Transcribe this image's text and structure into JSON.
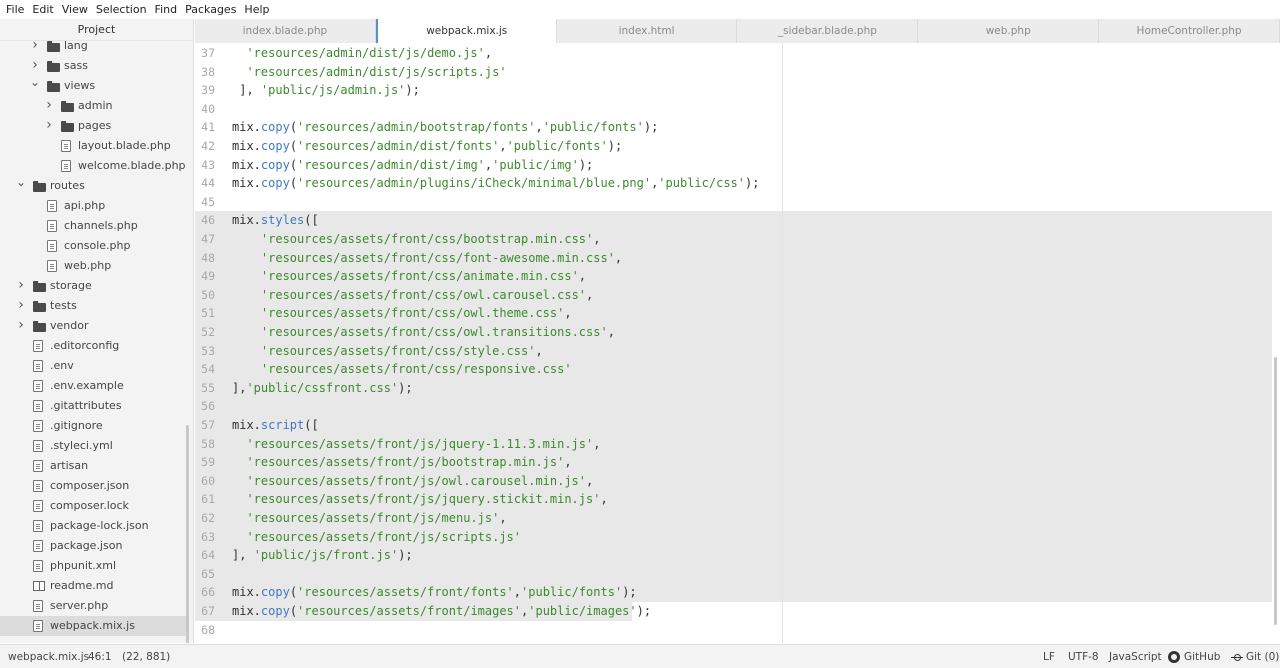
{
  "menubar": [
    "File",
    "Edit",
    "View",
    "Selection",
    "Find",
    "Packages",
    "Help"
  ],
  "sidebar": {
    "title": "Project",
    "items": [
      {
        "label": "lang",
        "kind": "folder",
        "depth": 2,
        "state": "collapsed",
        "icon": "folder-icon"
      },
      {
        "label": "sass",
        "kind": "folder",
        "depth": 2,
        "state": "collapsed",
        "icon": "folder-icon"
      },
      {
        "label": "views",
        "kind": "folder",
        "depth": 2,
        "state": "expanded",
        "icon": "folder-icon"
      },
      {
        "label": "admin",
        "kind": "folder",
        "depth": 3,
        "state": "collapsed",
        "icon": "folder-icon"
      },
      {
        "label": "pages",
        "kind": "folder",
        "depth": 3,
        "state": "collapsed",
        "icon": "folder-icon"
      },
      {
        "label": "layout.blade.php",
        "kind": "file",
        "depth": 3,
        "icon": "file-icon"
      },
      {
        "label": "welcome.blade.php",
        "kind": "file",
        "depth": 3,
        "icon": "file-icon"
      },
      {
        "label": "routes",
        "kind": "folder",
        "depth": 1,
        "state": "expanded",
        "icon": "folder-icon"
      },
      {
        "label": "api.php",
        "kind": "file",
        "depth": 2,
        "icon": "file-icon"
      },
      {
        "label": "channels.php",
        "kind": "file",
        "depth": 2,
        "icon": "file-icon"
      },
      {
        "label": "console.php",
        "kind": "file",
        "depth": 2,
        "icon": "file-icon"
      },
      {
        "label": "web.php",
        "kind": "file",
        "depth": 2,
        "icon": "file-icon"
      },
      {
        "label": "storage",
        "kind": "folder",
        "depth": 1,
        "state": "collapsed",
        "icon": "folder-icon"
      },
      {
        "label": "tests",
        "kind": "folder",
        "depth": 1,
        "state": "collapsed",
        "icon": "folder-icon"
      },
      {
        "label": "vendor",
        "kind": "folder",
        "depth": 1,
        "state": "collapsed",
        "icon": "folder-icon"
      },
      {
        "label": ".editorconfig",
        "kind": "file",
        "depth": 1,
        "icon": "file-icon"
      },
      {
        "label": ".env",
        "kind": "file",
        "depth": 1,
        "icon": "file-icon"
      },
      {
        "label": ".env.example",
        "kind": "file",
        "depth": 1,
        "icon": "file-icon"
      },
      {
        "label": ".gitattributes",
        "kind": "file",
        "depth": 1,
        "icon": "file-icon"
      },
      {
        "label": ".gitignore",
        "kind": "file",
        "depth": 1,
        "icon": "file-icon"
      },
      {
        "label": ".styleci.yml",
        "kind": "file",
        "depth": 1,
        "icon": "file-icon"
      },
      {
        "label": "artisan",
        "kind": "file",
        "depth": 1,
        "icon": "file-icon"
      },
      {
        "label": "composer.json",
        "kind": "file",
        "depth": 1,
        "icon": "file-icon"
      },
      {
        "label": "composer.lock",
        "kind": "file",
        "depth": 1,
        "icon": "file-icon"
      },
      {
        "label": "package-lock.json",
        "kind": "file",
        "depth": 1,
        "icon": "file-icon"
      },
      {
        "label": "package.json",
        "kind": "file",
        "depth": 1,
        "icon": "file-icon"
      },
      {
        "label": "phpunit.xml",
        "kind": "file",
        "depth": 1,
        "icon": "file-icon"
      },
      {
        "label": "readme.md",
        "kind": "file",
        "depth": 1,
        "icon": "book-icon"
      },
      {
        "label": "server.php",
        "kind": "file",
        "depth": 1,
        "icon": "file-icon"
      },
      {
        "label": "webpack.mix.js",
        "kind": "file",
        "depth": 1,
        "icon": "file-icon",
        "selected": true
      }
    ]
  },
  "tabs": [
    {
      "label": "index.blade.php",
      "active": false
    },
    {
      "label": "webpack.mix.js",
      "active": true
    },
    {
      "label": "index.html",
      "active": false
    },
    {
      "label": "_sidebar.blade.php",
      "active": false
    },
    {
      "label": "web.php",
      "active": false
    },
    {
      "label": "HomeController.php",
      "active": false
    }
  ],
  "editor": {
    "highlight_range": [
      46,
      67
    ],
    "lines": [
      {
        "n": "37",
        "tokens": [
          [
            "p",
            "  "
          ],
          [
            "s",
            "'resources/admin/dist/js/demo.js'"
          ],
          [
            "p",
            ","
          ]
        ]
      },
      {
        "n": "38",
        "tokens": [
          [
            "p",
            "  "
          ],
          [
            "s",
            "'resources/admin/dist/js/scripts.js'"
          ]
        ]
      },
      {
        "n": "39",
        "tokens": [
          [
            "p",
            " ], "
          ],
          [
            "s",
            "'public/js/admin.js'"
          ],
          [
            "p",
            ");"
          ]
        ]
      },
      {
        "n": "40",
        "tokens": []
      },
      {
        "n": "41",
        "tokens": [
          [
            "p",
            "mix."
          ],
          [
            "f",
            "copy"
          ],
          [
            "p",
            "("
          ],
          [
            "s",
            "'resources/admin/bootstrap/fonts'"
          ],
          [
            "p",
            ","
          ],
          [
            "s",
            "'public/fonts'"
          ],
          [
            "p",
            ");"
          ]
        ]
      },
      {
        "n": "42",
        "tokens": [
          [
            "p",
            "mix."
          ],
          [
            "f",
            "copy"
          ],
          [
            "p",
            "("
          ],
          [
            "s",
            "'resources/admin/dist/fonts'"
          ],
          [
            "p",
            ","
          ],
          [
            "s",
            "'public/fonts'"
          ],
          [
            "p",
            ");"
          ]
        ]
      },
      {
        "n": "43",
        "tokens": [
          [
            "p",
            "mix."
          ],
          [
            "f",
            "copy"
          ],
          [
            "p",
            "("
          ],
          [
            "s",
            "'resources/admin/dist/img'"
          ],
          [
            "p",
            ","
          ],
          [
            "s",
            "'public/img'"
          ],
          [
            "p",
            ");"
          ]
        ]
      },
      {
        "n": "44",
        "tokens": [
          [
            "p",
            "mix."
          ],
          [
            "f",
            "copy"
          ],
          [
            "p",
            "("
          ],
          [
            "s",
            "'resources/admin/plugins/iCheck/minimal/blue.png'"
          ],
          [
            "p",
            ","
          ],
          [
            "s",
            "'public/css'"
          ],
          [
            "p",
            ");"
          ]
        ]
      },
      {
        "n": "45",
        "tokens": []
      },
      {
        "n": "46",
        "tokens": [
          [
            "p",
            "mix."
          ],
          [
            "f",
            "styles"
          ],
          [
            "p",
            "(["
          ]
        ]
      },
      {
        "n": "47",
        "tokens": [
          [
            "p",
            "    "
          ],
          [
            "s",
            "'resources/assets/front/css/bootstrap.min.css'"
          ],
          [
            "p",
            ","
          ]
        ]
      },
      {
        "n": "48",
        "tokens": [
          [
            "p",
            "    "
          ],
          [
            "s",
            "'resources/assets/front/css/font-awesome.min.css'"
          ],
          [
            "p",
            ","
          ]
        ]
      },
      {
        "n": "49",
        "tokens": [
          [
            "p",
            "    "
          ],
          [
            "s",
            "'resources/assets/front/css/animate.min.css'"
          ],
          [
            "p",
            ","
          ]
        ]
      },
      {
        "n": "50",
        "tokens": [
          [
            "p",
            "    "
          ],
          [
            "s",
            "'resources/assets/front/css/owl.carousel.css'"
          ],
          [
            "p",
            ","
          ]
        ]
      },
      {
        "n": "51",
        "tokens": [
          [
            "p",
            "    "
          ],
          [
            "s",
            "'resources/assets/front/css/owl.theme.css'"
          ],
          [
            "p",
            ","
          ]
        ]
      },
      {
        "n": "52",
        "tokens": [
          [
            "p",
            "    "
          ],
          [
            "s",
            "'resources/assets/front/css/owl.transitions.css'"
          ],
          [
            "p",
            ","
          ]
        ]
      },
      {
        "n": "53",
        "tokens": [
          [
            "p",
            "    "
          ],
          [
            "s",
            "'resources/assets/front/css/style.css'"
          ],
          [
            "p",
            ","
          ]
        ]
      },
      {
        "n": "54",
        "tokens": [
          [
            "p",
            "    "
          ],
          [
            "s",
            "'resources/assets/front/css/responsive.css'"
          ]
        ]
      },
      {
        "n": "55",
        "tokens": [
          [
            "p",
            "],"
          ],
          [
            "s",
            "'public/cssfront.css'"
          ],
          [
            "p",
            ");"
          ]
        ]
      },
      {
        "n": "56",
        "tokens": []
      },
      {
        "n": "57",
        "tokens": [
          [
            "p",
            "mix."
          ],
          [
            "f",
            "script"
          ],
          [
            "p",
            "(["
          ]
        ]
      },
      {
        "n": "58",
        "tokens": [
          [
            "p",
            "  "
          ],
          [
            "s",
            "'resources/assets/front/js/jquery-1.11.3.min.js'"
          ],
          [
            "p",
            ","
          ]
        ]
      },
      {
        "n": "59",
        "tokens": [
          [
            "p",
            "  "
          ],
          [
            "s",
            "'resources/assets/front/js/bootstrap.min.js'"
          ],
          [
            "p",
            ","
          ]
        ]
      },
      {
        "n": "60",
        "tokens": [
          [
            "p",
            "  "
          ],
          [
            "s",
            "'resources/assets/front/js/owl.carousel.min.js'"
          ],
          [
            "p",
            ","
          ]
        ]
      },
      {
        "n": "61",
        "tokens": [
          [
            "p",
            "  "
          ],
          [
            "s",
            "'resources/assets/front/js/jquery.stickit.min.js'"
          ],
          [
            "p",
            ","
          ]
        ]
      },
      {
        "n": "62",
        "tokens": [
          [
            "p",
            "  "
          ],
          [
            "s",
            "'resources/assets/front/js/menu.js'"
          ],
          [
            "p",
            ","
          ]
        ]
      },
      {
        "n": "63",
        "tokens": [
          [
            "p",
            "  "
          ],
          [
            "s",
            "'resources/assets/front/js/scripts.js'"
          ]
        ]
      },
      {
        "n": "64",
        "tokens": [
          [
            "p",
            "], "
          ],
          [
            "s",
            "'public/js/front.js'"
          ],
          [
            "p",
            ");"
          ]
        ]
      },
      {
        "n": "65",
        "tokens": []
      },
      {
        "n": "66",
        "tokens": [
          [
            "p",
            "mix."
          ],
          [
            "f",
            "copy"
          ],
          [
            "p",
            "("
          ],
          [
            "s",
            "'resources/assets/front/fonts'"
          ],
          [
            "p",
            ","
          ],
          [
            "s",
            "'public/fonts'"
          ],
          [
            "p",
            ");"
          ]
        ]
      },
      {
        "n": "67",
        "tokens": [
          [
            "p",
            "mix."
          ],
          [
            "f",
            "copy"
          ],
          [
            "p",
            "("
          ],
          [
            "s",
            "'resources/assets/front/images'"
          ],
          [
            "p",
            ","
          ],
          [
            "s",
            "'public/images'"
          ],
          [
            "p",
            ");"
          ]
        ]
      },
      {
        "n": "68",
        "tokens": []
      }
    ]
  },
  "statusbar": {
    "file": "webpack.mix.js",
    "cursor": "46:1",
    "selection": "(22, 881)",
    "line_ending": "LF",
    "encoding": "UTF-8",
    "grammar": "JavaScript",
    "github": "GitHub",
    "git": "Git (0)"
  },
  "colors": {
    "string": "#3d8a2e",
    "function": "#4078c0",
    "selection_bg": "#e8e8e8",
    "active_tab_accent": "#5a8cd8"
  }
}
